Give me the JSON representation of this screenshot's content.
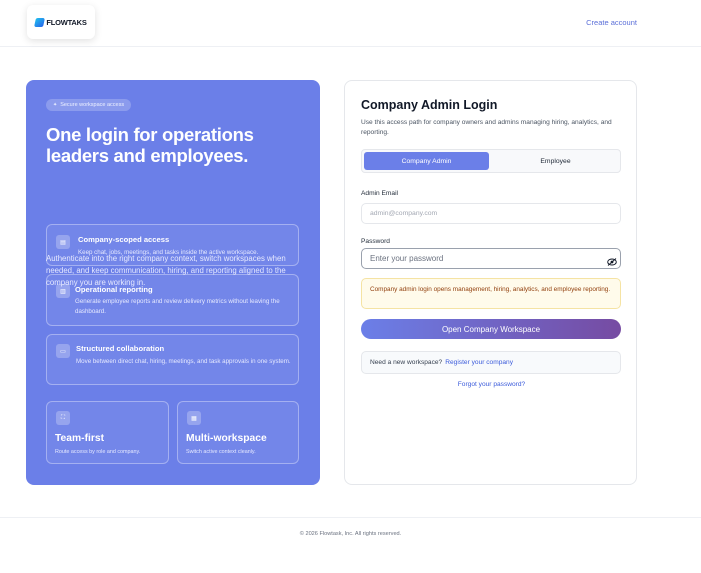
{
  "header": {
    "logo_text": "FLOWTAKS",
    "create_account": "Create account"
  },
  "hero": {
    "badge": "Secure workspace access",
    "title": "One login for operations leaders and employees.",
    "description": "Authenticate into the right company context, switch workspaces when needed, and keep communication, hiring, and reporting aligned to the company you are working in.",
    "features": [
      {
        "icon": "document-icon",
        "title": "Company-scoped access",
        "description": "Keep chat, jobs, meetings, and tasks inside the active workspace."
      },
      {
        "icon": "report-icon",
        "title": "Operational reporting",
        "description": "Generate employee reports and review delivery metrics without leaving the dashboard."
      },
      {
        "icon": "chat-icon",
        "title": "Structured collaboration",
        "description": "Move between direct chat, hiring, meetings, and task approvals in one system."
      }
    ],
    "stats": [
      {
        "icon": "users-icon",
        "title": "Team-first",
        "description": "Route access by role and company."
      },
      {
        "icon": "building-icon",
        "title": "Multi-workspace",
        "description": "Switch active context cleanly."
      }
    ]
  },
  "login": {
    "title": "Company Admin Login",
    "description": "Use this access path for company owners and admins managing hiring, analytics, and reporting.",
    "tabs": [
      "Company Admin",
      "Employee"
    ],
    "active_tab": "Company Admin",
    "email_label": "Admin Email",
    "email_placeholder": "admin@company.com",
    "email_value": "",
    "password_label": "Password",
    "password_placeholder": "Enter your password",
    "password_value": "",
    "notice": "Company admin login opens management, hiring, analytics, and employee reporting.",
    "submit_label": "Open Company Workspace",
    "register_prompt": "Need a new workspace?",
    "register_link": "Register your company",
    "forgot_link": "Forgot your password?"
  },
  "footer": {
    "copyright": "© 2026 Flowtask, Inc. All rights reserved."
  },
  "colors": {
    "brand": "#6b7fe8",
    "button_gradient_end": "#764ba2",
    "notice_bg": "#fffbeb",
    "link": "#3b5bdb"
  }
}
